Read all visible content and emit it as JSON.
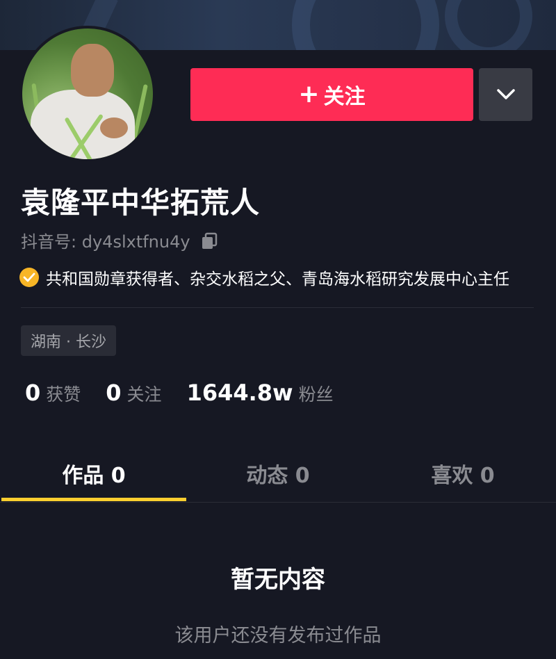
{
  "profile": {
    "name": "袁隆平中华拓荒人",
    "douyin_id_label": "抖音号:",
    "douyin_id": "dy4slxtfnu4y",
    "verification": "共和国勋章获得者、杂交水稻之父、青岛海水稻研究发展中心主任",
    "location": "湖南 · 长沙"
  },
  "actions": {
    "follow_plus": "+",
    "follow_label": "关注",
    "more_icon": "chevron-down-icon"
  },
  "stats": [
    {
      "value": "0",
      "label": "获赞"
    },
    {
      "value": "0",
      "label": "关注"
    },
    {
      "value": "1644.8w",
      "label": "粉丝"
    }
  ],
  "tabs": [
    {
      "label": "作品 0",
      "active": true
    },
    {
      "label": "动态 0",
      "active": false
    },
    {
      "label": "喜欢 0",
      "active": false
    }
  ],
  "empty_state": {
    "title": "暂无内容",
    "description": "该用户还没有发布过作品"
  },
  "colors": {
    "background": "#161823",
    "follow_button": "#fe2c55",
    "tab_indicator": "#fece2f",
    "verify_badge": "#f7b526",
    "muted_text": "#8a8b91"
  }
}
